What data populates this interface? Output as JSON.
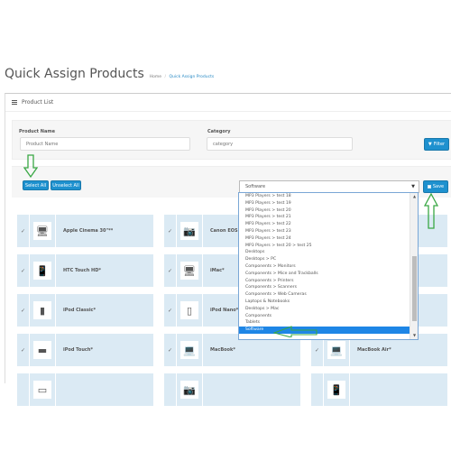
{
  "page": {
    "title": "Quick Assign Products",
    "breadcrumb": [
      {
        "label": "Home"
      },
      {
        "label": "Quick Assign Products"
      }
    ]
  },
  "panel": {
    "heading": "Product List",
    "heading_icon": "list-icon"
  },
  "filter": {
    "product_name_label": "Product Name",
    "product_name_placeholder": "Product Name",
    "product_name_value": "",
    "category_label": "Category",
    "category_placeholder": "category",
    "category_value": "",
    "filter_button": "Filter",
    "filter_icon": "filter-icon"
  },
  "actions": {
    "select_all": "Select All",
    "unselect_all": "Unselect All",
    "save_button": "Save",
    "save_icon": "floppy-disk-icon",
    "category_selected": "Software"
  },
  "dropdown": {
    "options": [
      "MP3 Players  >  test 18",
      "MP3 Players  >  test 19",
      "MP3 Players  >  test 20",
      "MP3 Players  >  test 21",
      "MP3 Players  >  test 22",
      "MP3 Players  >  test 23",
      "MP3 Players  >  test 24",
      "MP3 Players  >  test 20  >  test 25",
      "Desktops",
      "Desktops  >  PC",
      "Components  >  Monitors",
      "Components  >  Mice and Trackballs",
      "Components  >  Printers",
      "Components  >  Scanners",
      "Components  >  Web Cameras",
      "Laptops & Notebooks",
      "Desktops  >  Mac",
      "Components",
      "Tablets",
      "Software"
    ],
    "selected_index": 19
  },
  "products": [
    {
      "name": "Apple Cinema 30\"**",
      "checked": true,
      "icon": "monitor-icon"
    },
    {
      "name": "Canon EOS 5D*",
      "checked": true,
      "icon": "camera-icon"
    },
    {
      "name": "",
      "checked": true,
      "icon": ""
    },
    {
      "name": "HTC Touch HD*",
      "checked": true,
      "icon": "phone-icon"
    },
    {
      "name": "iMac*",
      "checked": true,
      "icon": "imac-icon"
    },
    {
      "name": "",
      "checked": true,
      "icon": ""
    },
    {
      "name": "iPod Classic*",
      "checked": true,
      "icon": "ipod-classic-icon"
    },
    {
      "name": "iPod Nano*",
      "checked": true,
      "icon": "ipod-nano-icon"
    },
    {
      "name": "",
      "checked": true,
      "icon": ""
    },
    {
      "name": "iPod Touch*",
      "checked": true,
      "icon": "ipod-touch-icon"
    },
    {
      "name": "MacBook*",
      "checked": true,
      "icon": "laptop-icon"
    },
    {
      "name": "MacBook Air*",
      "checked": true,
      "icon": "laptop-icon"
    },
    {
      "name": "",
      "checked": false,
      "icon": "product-icon"
    },
    {
      "name": "",
      "checked": false,
      "icon": "camera-icon"
    },
    {
      "name": "",
      "checked": false,
      "icon": "phone-icon"
    }
  ],
  "colors": {
    "primary": "#1e91cf",
    "card_bg": "#dbeaf4",
    "selected_option": "#1e86e6",
    "annotation_arrow": "#3aa845"
  }
}
